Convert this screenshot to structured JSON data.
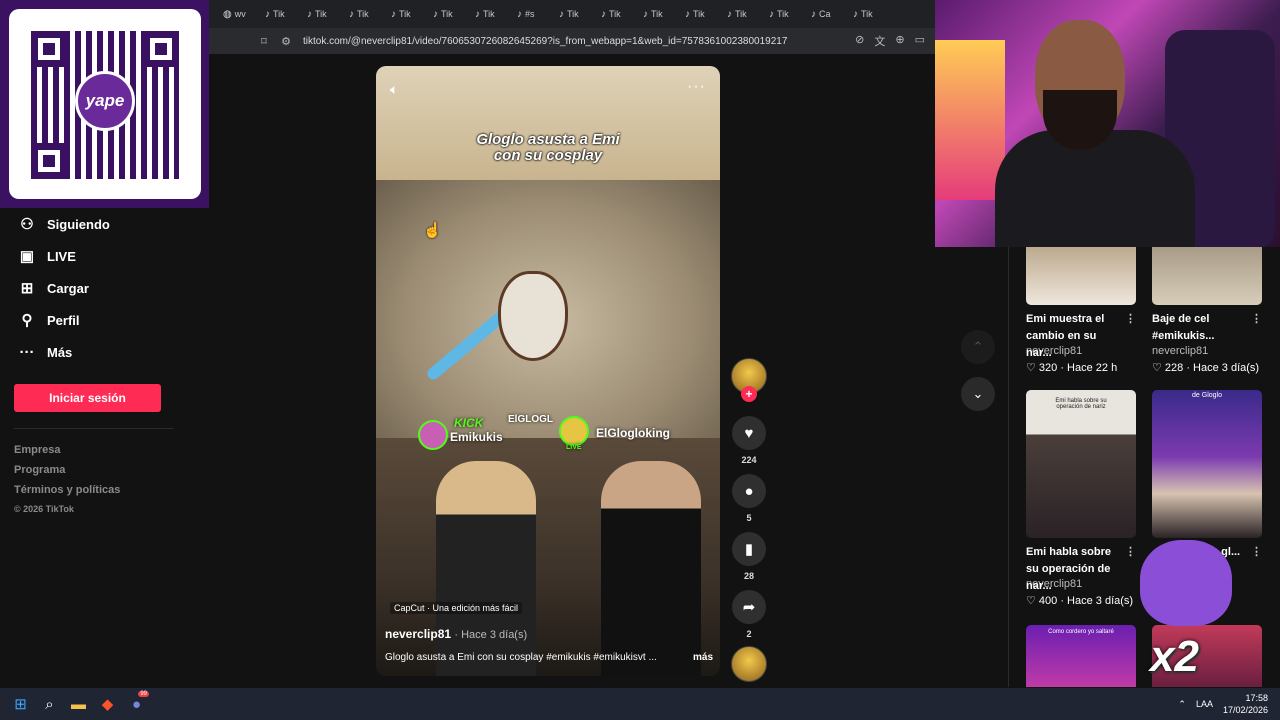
{
  "overlay": {
    "qr_logo_text": "yape"
  },
  "browser": {
    "tabs": [
      {
        "icon": "globe-icon",
        "label": "wv"
      },
      {
        "icon": "tiktok-icon",
        "label": "Tik"
      },
      {
        "icon": "tiktok-icon",
        "label": "Tik"
      },
      {
        "icon": "tiktok-icon",
        "label": "Tik"
      },
      {
        "icon": "tiktok-icon",
        "label": "Tik"
      },
      {
        "icon": "tiktok-icon",
        "label": "Tik"
      },
      {
        "icon": "tiktok-icon",
        "label": "Tik"
      },
      {
        "icon": "tiktok-icon",
        "label": "#s"
      },
      {
        "icon": "tiktok-icon",
        "label": "Tik"
      },
      {
        "icon": "tiktok-icon",
        "label": "Tik"
      },
      {
        "icon": "tiktok-icon",
        "label": "Tik"
      },
      {
        "icon": "tiktok-icon",
        "label": "Tik"
      },
      {
        "icon": "tiktok-icon",
        "label": "Tik"
      },
      {
        "icon": "tiktok-icon",
        "label": "Tik"
      },
      {
        "icon": "tiktok-icon",
        "label": "Ca"
      },
      {
        "icon": "tiktok-icon",
        "label": "Tik"
      }
    ],
    "url": "tiktok.com/@neverclip81/video/7606530726082645269?is_from_webapp=1&web_id=7578361002380019217"
  },
  "sidebar": {
    "items": [
      {
        "icon": "following-icon",
        "label": "Siguiendo"
      },
      {
        "icon": "live-icon",
        "label": "LIVE"
      },
      {
        "icon": "upload-icon",
        "label": "Cargar"
      },
      {
        "icon": "profile-icon",
        "label": "Perfil"
      },
      {
        "icon": "more-dots-icon",
        "label": "Más"
      }
    ],
    "login_label": "Iniciar sesión",
    "footer": [
      "Empresa",
      "Programa",
      "Términos y políticas"
    ],
    "copyright": "© 2026 TikTok"
  },
  "video": {
    "caption_line1": "Gloglo asusta a Emi",
    "caption_line2": "con su cosplay",
    "kick_label": "KICK",
    "streamer1": "Emikukis",
    "streamer_tag": "ElGLOGL",
    "streamer2": "ElGlogloking",
    "live_badge": "LIVE",
    "capcut": "CapCut · Una edición más fácil",
    "author": "neverclip81",
    "time": "· Hace 3 día(s)",
    "description": "Gloglo asusta a Emi con su cosplay #emikukis #emikukisvt ...",
    "more_label": "más"
  },
  "actions": {
    "likes": "224",
    "comments": "5",
    "saves": "28",
    "shares": "2"
  },
  "related": [
    {
      "title": "Emi muestra el cambio en su nar...",
      "author": "neverclip81",
      "meta": "320 · Hace 22 h"
    },
    {
      "title": "Baje de cel #emikukis...",
      "author": "neverclip81",
      "meta": "228 · Hace 3 día(s)"
    },
    {
      "title": "Emi habla sobre su operación de nar...",
      "author": "neverclip81",
      "meta": "400 · Hace 3 día(s)"
    },
    {
      "title": "...gl...",
      "author": "",
      "meta": ""
    }
  ],
  "thumb_texts": {
    "t3": "Emi habla sobre su operación de nariz",
    "t4": "de Gloglo",
    "t5": "Como cordero yo saltaré"
  },
  "sticker": {
    "multiplier": "x2"
  },
  "taskbar": {
    "lang": "LAA",
    "time": "17:58",
    "date": "17/02/2026",
    "discord_badge": "99"
  },
  "colors": {
    "accent": "#fe2c55",
    "kick": "#53fc18",
    "bg": "#121212"
  }
}
